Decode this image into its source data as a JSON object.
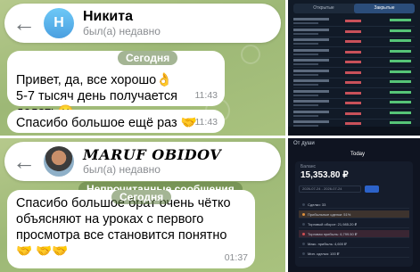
{
  "chat1": {
    "contact_name": "Никита",
    "avatar_letter": "Н",
    "status": "был(а) недавно",
    "date_pill": "Сегодня",
    "messages": [
      {
        "text": "Привет, да, все хорошо👌\n5-7 тысяч день получается делать😄",
        "time": "11:43"
      },
      {
        "text": "Спасибо большое ещё раз 🤝",
        "time": "11:43"
      }
    ]
  },
  "chat2": {
    "contact_name": "MARUF OBIDOV",
    "status": "был(а) недавно",
    "unread_pill": "Непрочитанные сообщения",
    "date_pill": "Сегодня",
    "messages": [
      {
        "text": "Спасибо большое брат очень чётко объясняют на уроках с первого просмотра все становится понятно 🤝 🤝🤝",
        "time": "01:37"
      }
    ]
  },
  "screenshot1": {
    "tabs": [
      "Открытые",
      "Закрытые"
    ]
  },
  "screenshot2": {
    "top_label": "От души",
    "today_label": "Today",
    "balance_label": "Баланс",
    "balance": "15,353.80 ₽",
    "date_range": "2026-07-24 - 2026-07-24",
    "rows": [
      {
        "label": "Сделки: 33",
        "color": "#3a4556"
      },
      {
        "label": "Прибыльные сделки: 51%",
        "color": "#e0913c"
      },
      {
        "label": "Торговый оборот: 21,985.20 ₽",
        "color": "#3a4556"
      },
      {
        "label": "Торговая прибыль: 6,799.50 ₽",
        "color": "#d04f54"
      },
      {
        "label": "Макс. прибыль: 4,600 ₽",
        "color": "#3a4556"
      },
      {
        "label": "Мин. сделка: 100 ₽",
        "color": "#3a4556"
      }
    ]
  },
  "colors": {
    "chat_background": "#a4bf7c",
    "bubble": "#ffffff",
    "avatar_gradient": "#4a9fe0",
    "app_dark": "#111a27",
    "profit_green": "#56c477",
    "loss_red": "#c8515a"
  },
  "icons": {
    "back": "back-arrow-icon"
  }
}
